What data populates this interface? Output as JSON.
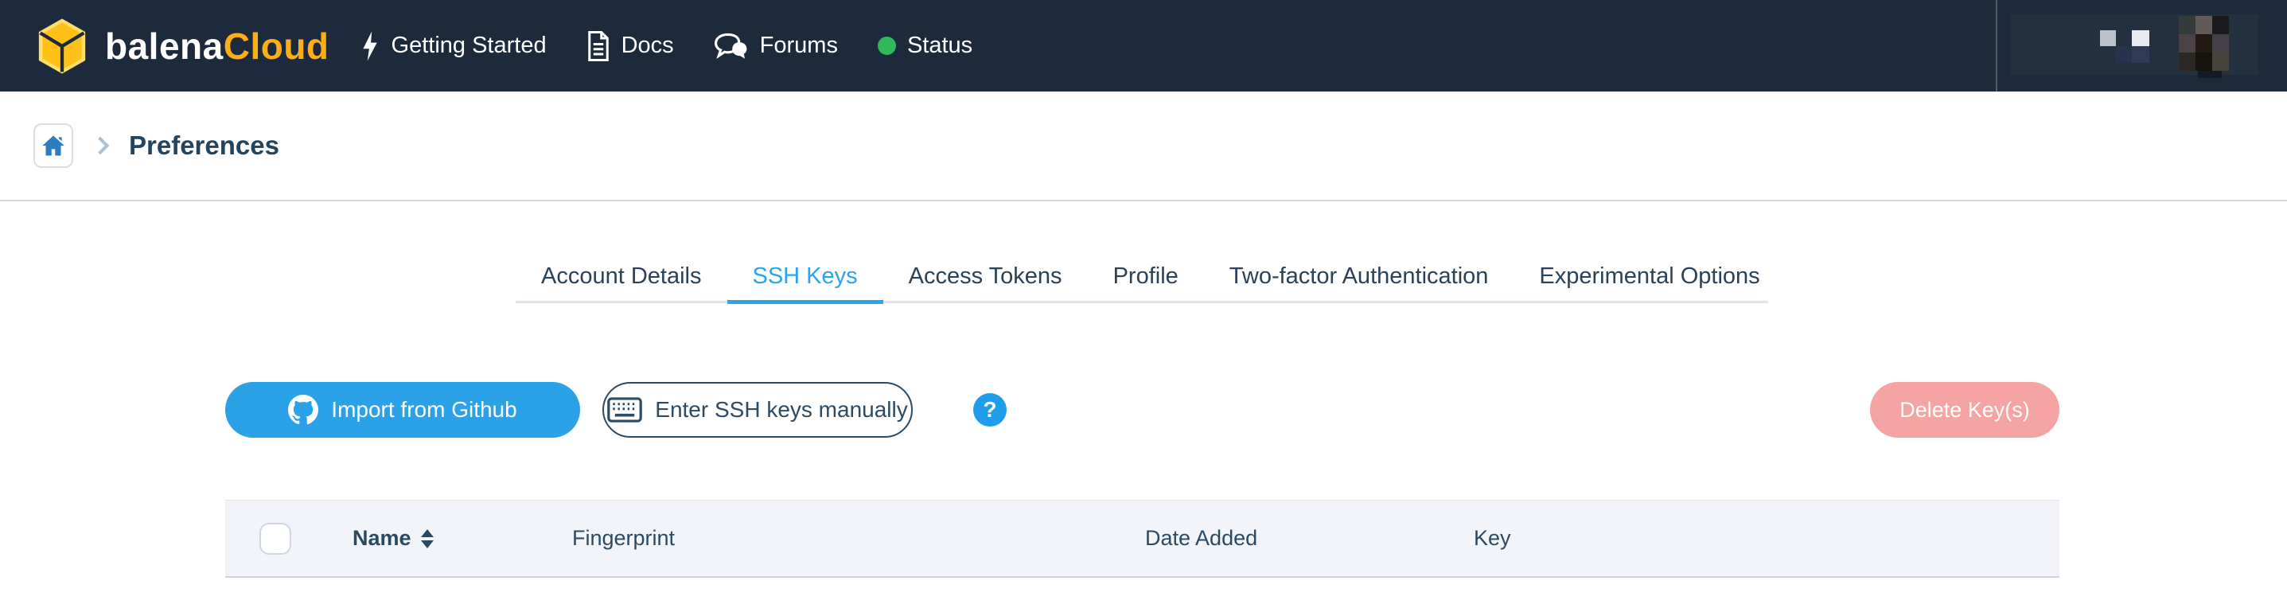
{
  "navbar": {
    "brand": {
      "primary": "balena",
      "secondary": "Cloud",
      "logo_icon": "balena-cube-icon"
    },
    "links": [
      {
        "label": "Getting Started",
        "icon": "lightning-icon"
      },
      {
        "label": "Docs",
        "icon": "document-icon"
      },
      {
        "label": "Forums",
        "icon": "chat-bubbles-icon"
      },
      {
        "label": "Status",
        "icon": "status-dot",
        "status_color": "#30b95c"
      }
    ]
  },
  "breadcrumb": {
    "home_icon": "home-icon",
    "current": "Preferences"
  },
  "tabs": [
    {
      "label": "Account Details",
      "active": false
    },
    {
      "label": "SSH Keys",
      "active": true
    },
    {
      "label": "Access Tokens",
      "active": false
    },
    {
      "label": "Profile",
      "active": false
    },
    {
      "label": "Two-factor Authentication",
      "active": false
    },
    {
      "label": "Experimental Options",
      "active": false
    }
  ],
  "toolbar": {
    "import_github": "Import from Github",
    "import_icon": "github-icon",
    "enter_manually": "Enter SSH keys manually",
    "enter_icon": "keyboard-icon",
    "help_glyph": "?",
    "delete_keys": "Delete Key(s)",
    "delete_enabled": false
  },
  "ssh_keys_table": {
    "columns": [
      "Name",
      "Fingerprint",
      "Date Added",
      "Key"
    ],
    "sorted_column": "Name",
    "rows": []
  },
  "colors": {
    "navbar_bg": "#1d2a3c",
    "accent_blue": "#2aa5ec",
    "primary_button_blue": "#2ba2e8",
    "help_blue": "#1f9ded",
    "danger_disabled_pink": "#f5a3a3",
    "status_green": "#30b95c",
    "brand_yellow": "#fbae17",
    "heading_navy": "#23445e"
  }
}
